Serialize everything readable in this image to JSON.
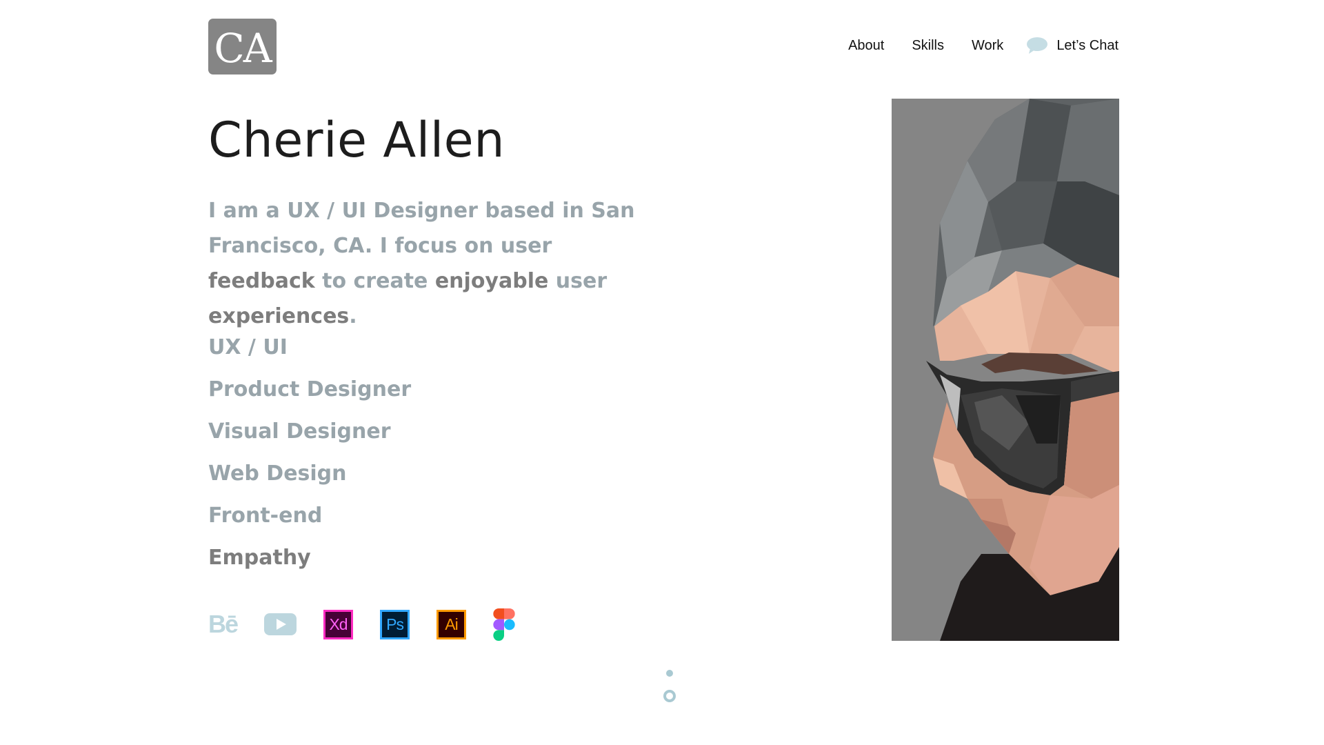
{
  "logo": {
    "text": "CA",
    "color": "#858585"
  },
  "nav": {
    "items": [
      "About",
      "Skills",
      "Work"
    ],
    "chat_label": "Let’s Chat",
    "chat_icon": "speech-bubble-icon",
    "chat_icon_color": "#c5dde4"
  },
  "hero": {
    "name": "Cherie Allen",
    "bio": [
      {
        "text": "I am a UX / UI Designer based in San Francisco, CA. I focus on user ",
        "em": false
      },
      {
        "text": "feedback",
        "em": true
      },
      {
        "text": " to create ",
        "em": false
      },
      {
        "text": "enjoyable",
        "em": true
      },
      {
        "text": " user ",
        "em": false
      },
      {
        "text": "experiences",
        "em": true
      },
      {
        "text": ".",
        "em": false
      }
    ],
    "roles": [
      {
        "label": "UX / UI",
        "emphasized": false
      },
      {
        "label": "Product Designer",
        "emphasized": false
      },
      {
        "label": "Visual Designer",
        "emphasized": false
      },
      {
        "label": "Web Design",
        "emphasized": false
      },
      {
        "label": "Front-end",
        "emphasized": false
      },
      {
        "label": "Empathy",
        "emphasized": true
      }
    ]
  },
  "tools": {
    "behance": {
      "label": "Bē",
      "icon": "behance-icon"
    },
    "youtube": {
      "icon": "youtube-icon"
    },
    "xd": {
      "label": "Xd",
      "icon": "adobe-xd-icon"
    },
    "ps": {
      "label": "Ps",
      "icon": "adobe-photoshop-icon"
    },
    "ai": {
      "label": "Ai",
      "icon": "adobe-illustrator-icon"
    },
    "figma": {
      "icon": "figma-icon"
    }
  },
  "portrait": {
    "icon": "low-poly-portrait",
    "background": "#858585"
  },
  "colors": {
    "text_dark": "#1d1d1d",
    "text_muted": "#98a4aa",
    "text_emphasis": "#7d7d7d",
    "accent_light_blue": "#c5dde4"
  }
}
